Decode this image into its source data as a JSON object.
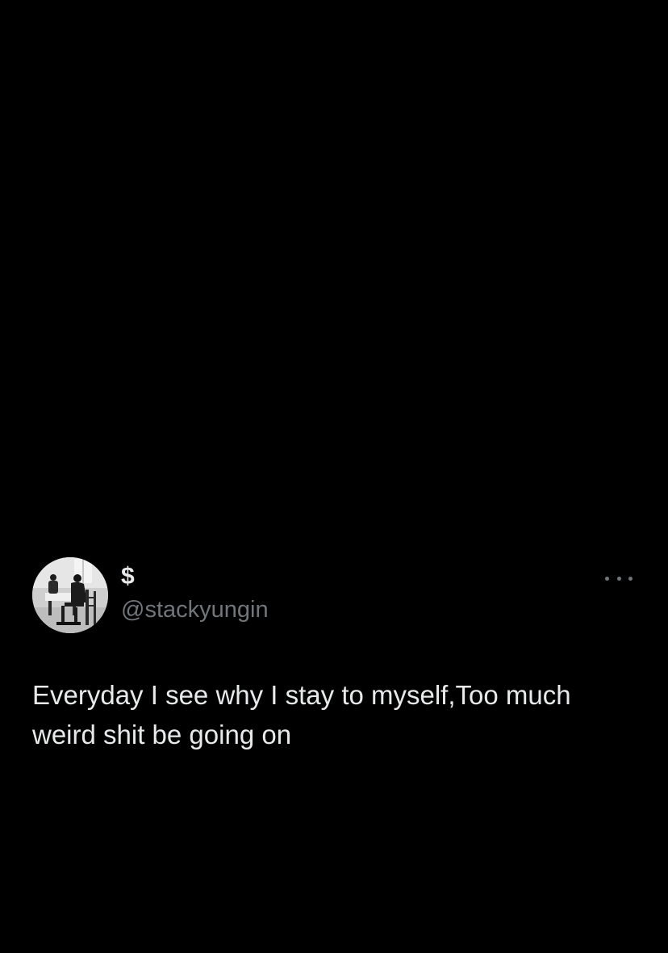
{
  "tweet": {
    "display_name": "$",
    "handle": "@stackyungin",
    "text": "Everyday I see why I stay to myself,Too much\nweird shit be going on",
    "avatar_icon": "profile-photo",
    "more_icon": "more-horizontal-icon"
  },
  "colors": {
    "background": "#000000",
    "primary_text": "#e7e9ea",
    "secondary_text": "#71767b"
  }
}
